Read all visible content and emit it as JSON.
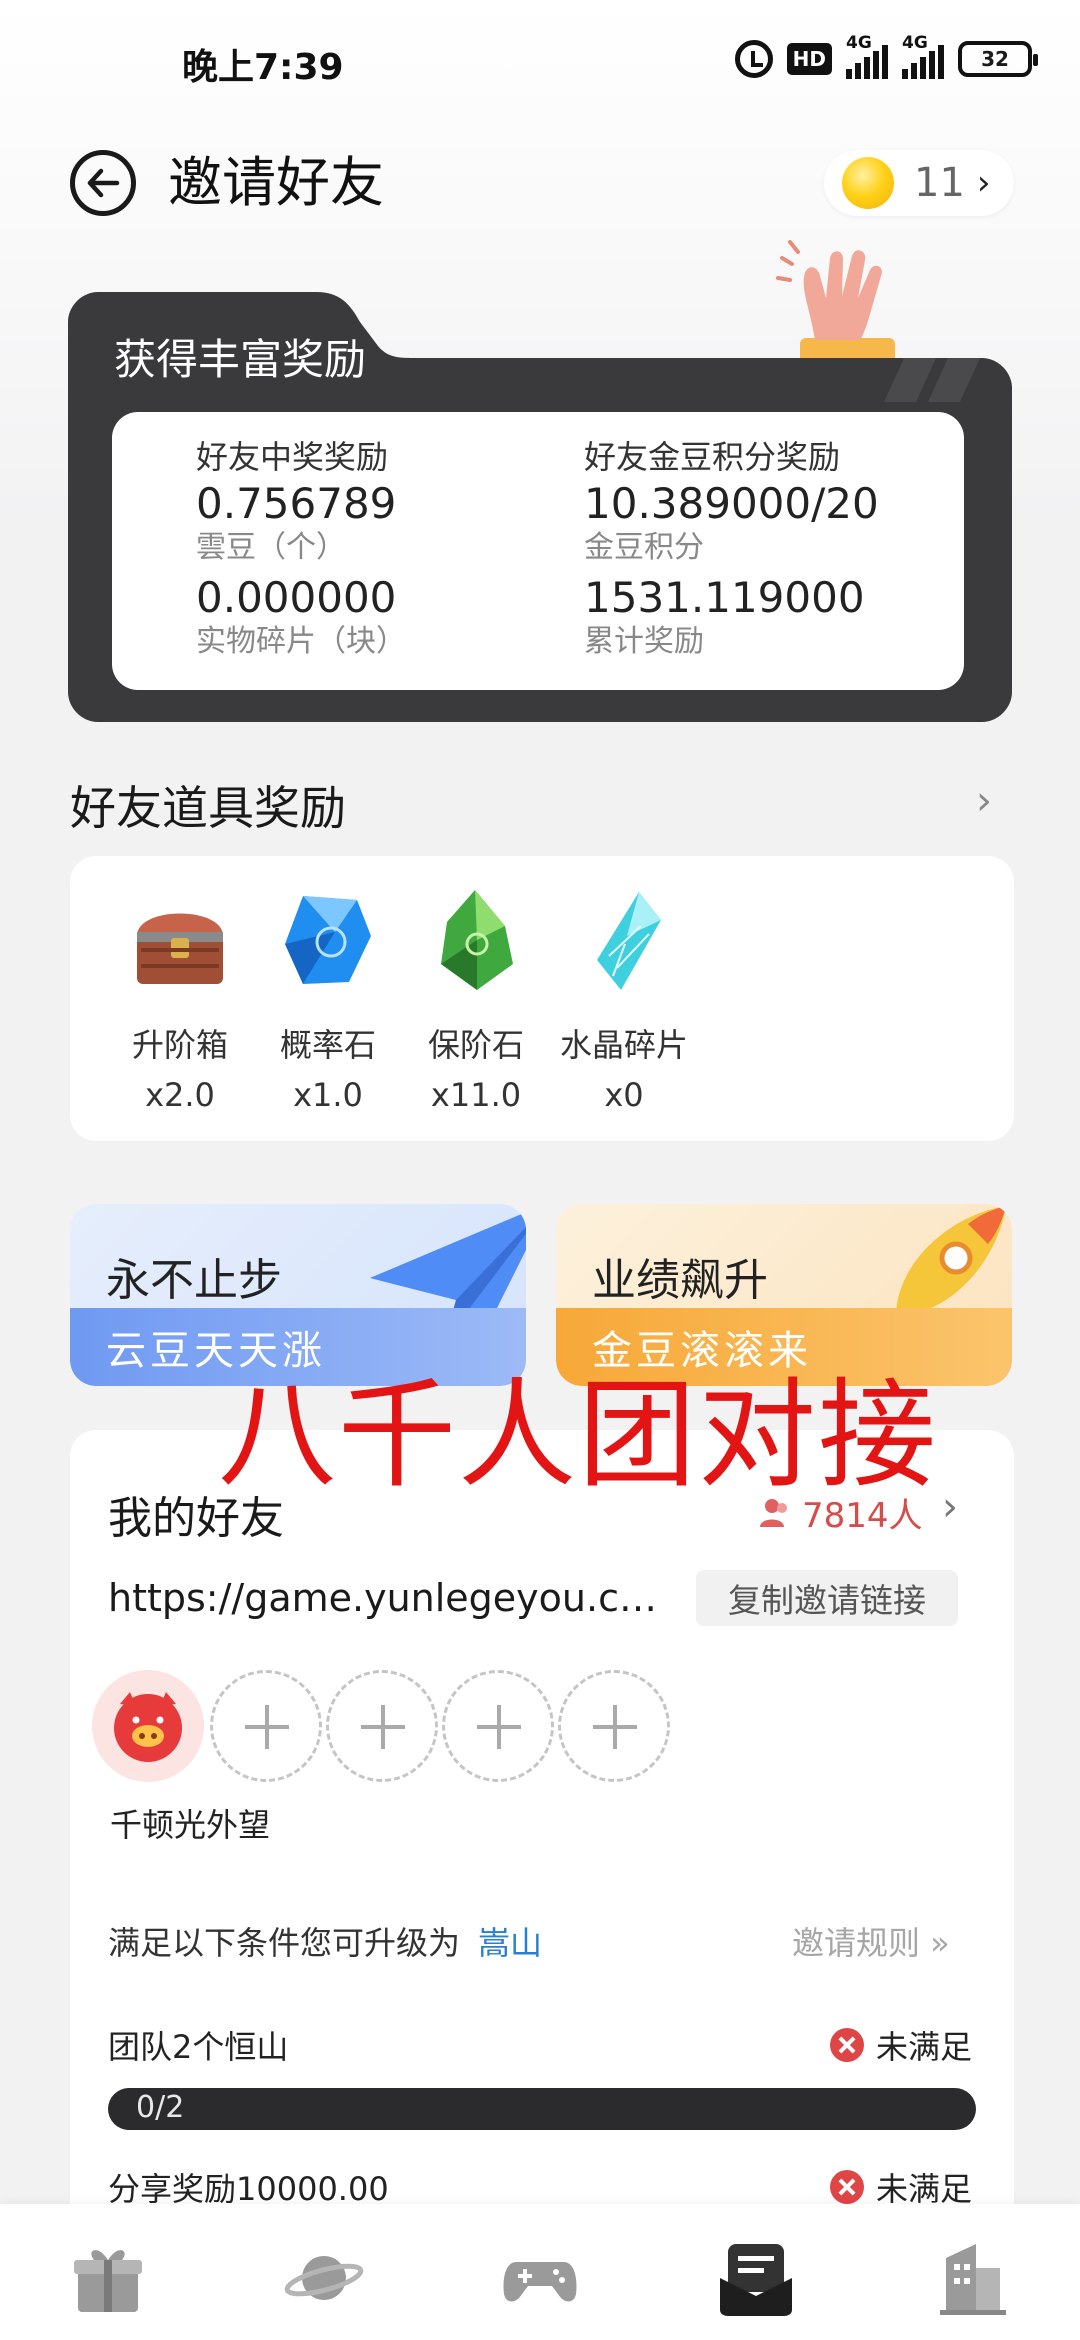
{
  "status_bar": {
    "time": "晚上7:39",
    "hd_label": "HD",
    "network_1": "4G",
    "network_2": "4G",
    "battery": "32"
  },
  "header": {
    "title": "邀请好友",
    "coin_count": "11",
    "coin_arrow": "›"
  },
  "reward": {
    "title": "获得丰富奖励",
    "items": [
      {
        "label": "好友中奖奖励",
        "value": "0.756789",
        "caption": "雲豆（个）",
        "value2": "0.000000",
        "caption2": "实物碎片（块）"
      },
      {
        "label": "好友金豆积分奖励",
        "value": "10.389000/20",
        "caption": "金豆积分",
        "value2": "1531.119000",
        "caption2": "累计奖励"
      }
    ]
  },
  "props": {
    "heading": "好友道具奖励",
    "arrow": "›",
    "items": [
      {
        "name": "升阶箱",
        "count": "x2.0",
        "icon": "treasure-chest-icon"
      },
      {
        "name": "概率石",
        "count": "x1.0",
        "icon": "blue-gem-icon"
      },
      {
        "name": "保阶石",
        "count": "x11.0",
        "icon": "green-gem-icon"
      },
      {
        "name": "水晶碎片",
        "count": "x0",
        "icon": "crystal-shard-icon"
      }
    ]
  },
  "banners": [
    {
      "title": "永不止步",
      "subtitle": "云豆天天涨",
      "color": "#7fa7f7"
    },
    {
      "title": "业绩飙升",
      "subtitle": "金豆滚滚来",
      "color": "#f9b24a"
    }
  ],
  "overlay": {
    "text": "八千人团对接",
    "color": "#e31414"
  },
  "friends": {
    "heading": "我的好友",
    "count": "7814人",
    "arrow": "›",
    "invite_link": "https://game.yunlegeyou.co…",
    "copy_button": "复制邀请链接",
    "friend_name": "千顿光外望",
    "upgrade_text": "满足以下条件您可升级为",
    "upgrade_target": "嵩山",
    "rules_link": "邀请规则 »",
    "conditions": [
      {
        "label": "团队2个恒山",
        "status": "未满足"
      },
      {
        "label": "分享奖励10000.00",
        "status": "未满足"
      }
    ],
    "progress_text": "0/2",
    "progress_fraction": 0
  },
  "bottom_nav": [
    "gift-icon",
    "planet-icon",
    "gamepad-icon",
    "message-inbox-icon",
    "building-icon"
  ]
}
